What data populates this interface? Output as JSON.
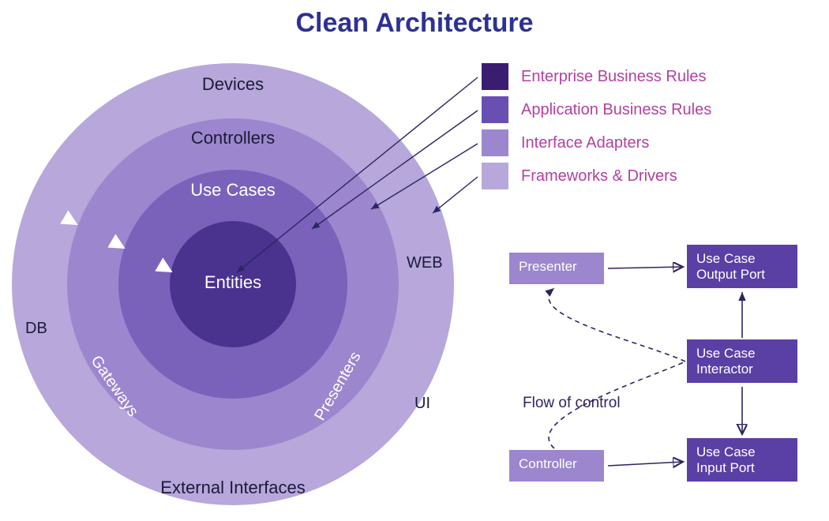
{
  "title": "Clean Architecture",
  "rings": {
    "entities": "Entities",
    "usecases": "Use Cases",
    "controllers": "Controllers",
    "gateways": "Gateways",
    "presenters": "Presenters",
    "devices": "Devices",
    "external": "External Interfaces",
    "db": "DB",
    "web": "WEB",
    "ui": "UI"
  },
  "legend": [
    {
      "color": "#3a1c71",
      "label": "Enterprise Business Rules"
    },
    {
      "color": "#6a4fb3",
      "label": "Application Business Rules"
    },
    {
      "color": "#9c86ce",
      "label": "Interface Adapters"
    },
    {
      "color": "#b7a7db",
      "label": "Frameworks & Drivers"
    }
  ],
  "flow": {
    "presenter": "Presenter",
    "controller": "Controller",
    "output": "Use Case Output Port",
    "interactor": "Use Case Interactor",
    "input": "Use Case Input Port",
    "label": "Flow of control"
  }
}
